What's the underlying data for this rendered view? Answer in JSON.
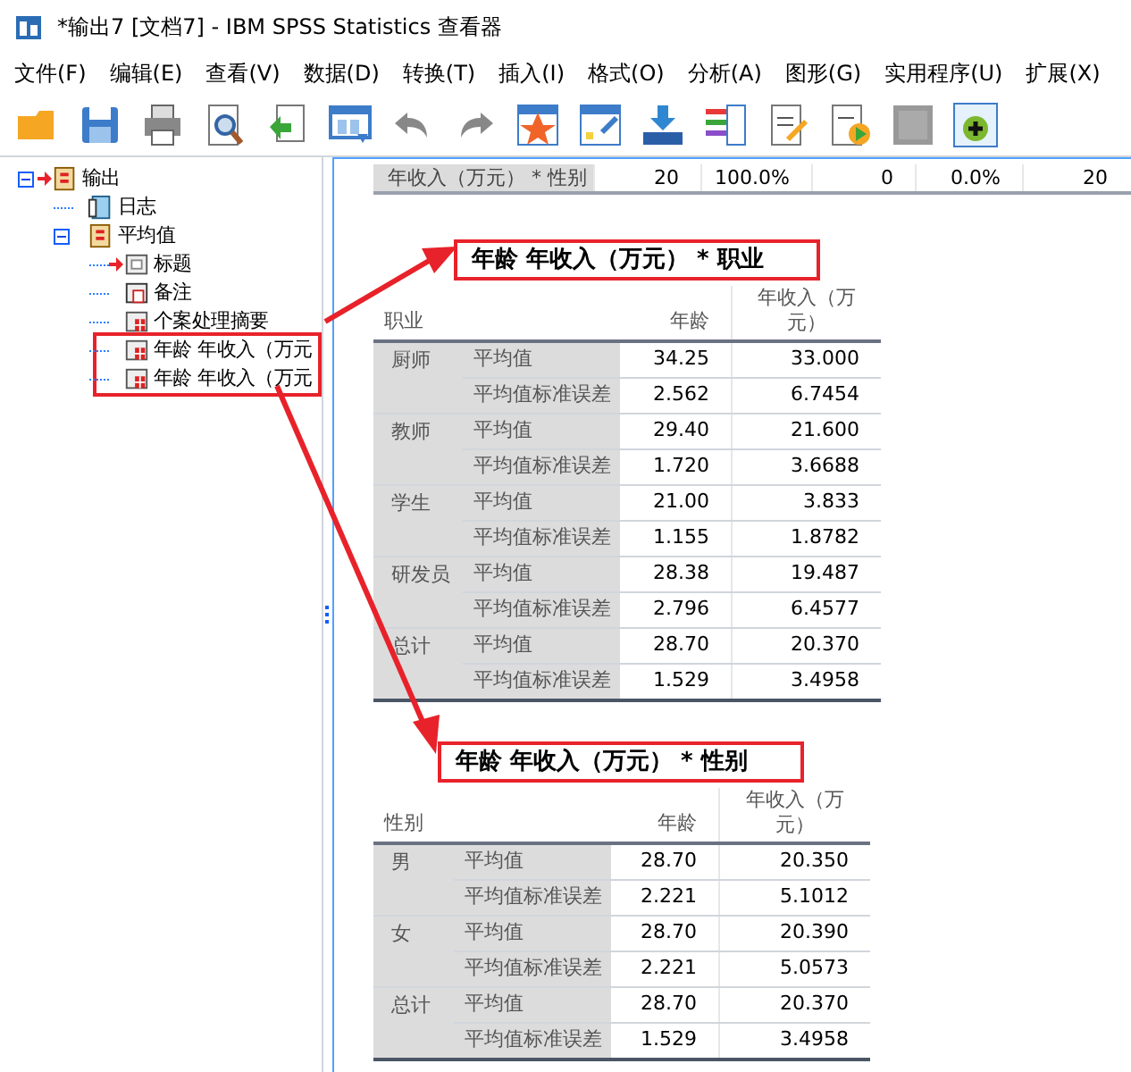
{
  "window": {
    "title": "*输出7 [文档7] - IBM SPSS Statistics 查看器"
  },
  "menu": [
    "文件(F)",
    "编辑(E)",
    "查看(V)",
    "数据(D)",
    "转换(T)",
    "插入(I)",
    "格式(O)",
    "分析(A)",
    "图形(G)",
    "实用程序(U)",
    "扩展(X)"
  ],
  "tree": [
    {
      "label": "输出",
      "kind": "book",
      "expanded": true,
      "current": true,
      "highlighted": false,
      "children": [
        {
          "label": "日志",
          "kind": "log",
          "highlighted": false
        },
        {
          "label": "平均值",
          "kind": "book",
          "expanded": true,
          "current": false,
          "highlighted": false,
          "children": [
            {
              "label": "标题",
              "kind": "title",
              "current": true,
              "highlighted": false
            },
            {
              "label": "备注",
              "kind": "notes",
              "current": false,
              "highlighted": false
            },
            {
              "label": "个案处理摘要",
              "kind": "table",
              "current": false,
              "highlighted": false
            },
            {
              "label": "年龄 年收入（万元",
              "kind": "table",
              "current": false,
              "highlighted": true
            },
            {
              "label": "年龄 年收入（万元",
              "kind": "table",
              "current": false,
              "highlighted": true
            }
          ]
        }
      ]
    }
  ],
  "top_row": {
    "label": "年收入（万元） * 性别",
    "cells": [
      "20",
      "100.0%",
      "0",
      "0.0%",
      "20"
    ]
  },
  "tables": [
    {
      "title": "年龄 年收入（万元） * 职业",
      "highlighted": true,
      "columns": [
        "职业",
        "年龄",
        "年收入（万元）"
      ],
      "groups": [
        {
          "label": "厨师",
          "rows": [
            {
              "stat": "平均值",
              "values": [
                "34.25",
                "33.000"
              ]
            },
            {
              "stat": "平均值标准误差",
              "values": [
                "2.562",
                "6.7454"
              ]
            }
          ]
        },
        {
          "label": "教师",
          "rows": [
            {
              "stat": "平均值",
              "values": [
                "29.40",
                "21.600"
              ]
            },
            {
              "stat": "平均值标准误差",
              "values": [
                "1.720",
                "3.6688"
              ]
            }
          ]
        },
        {
          "label": "学生",
          "rows": [
            {
              "stat": "平均值",
              "values": [
                "21.00",
                "3.833"
              ]
            },
            {
              "stat": "平均值标准误差",
              "values": [
                "1.155",
                "1.8782"
              ]
            }
          ]
        },
        {
          "label": "研发员",
          "rows": [
            {
              "stat": "平均值",
              "values": [
                "28.38",
                "19.487"
              ]
            },
            {
              "stat": "平均值标准误差",
              "values": [
                "2.796",
                "6.4577"
              ]
            }
          ]
        },
        {
          "label": "总计",
          "rows": [
            {
              "stat": "平均值",
              "values": [
                "28.70",
                "20.370"
              ]
            },
            {
              "stat": "平均值标准误差",
              "values": [
                "1.529",
                "3.4958"
              ]
            }
          ]
        }
      ]
    },
    {
      "title": "年龄 年收入（万元） * 性别",
      "highlighted": true,
      "columns": [
        "性别",
        "年龄",
        "年收入（万元）"
      ],
      "groups": [
        {
          "label": "男",
          "rows": [
            {
              "stat": "平均值",
              "values": [
                "28.70",
                "20.350"
              ]
            },
            {
              "stat": "平均值标准误差",
              "values": [
                "2.221",
                "5.1012"
              ]
            }
          ]
        },
        {
          "label": "女",
          "rows": [
            {
              "stat": "平均值",
              "values": [
                "28.70",
                "20.390"
              ]
            },
            {
              "stat": "平均值标准误差",
              "values": [
                "2.221",
                "5.0573"
              ]
            }
          ]
        },
        {
          "label": "总计",
          "rows": [
            {
              "stat": "平均值",
              "values": [
                "28.70",
                "20.370"
              ]
            },
            {
              "stat": "平均值标准误差",
              "values": [
                "1.529",
                "3.4958"
              ]
            }
          ]
        }
      ]
    }
  ]
}
